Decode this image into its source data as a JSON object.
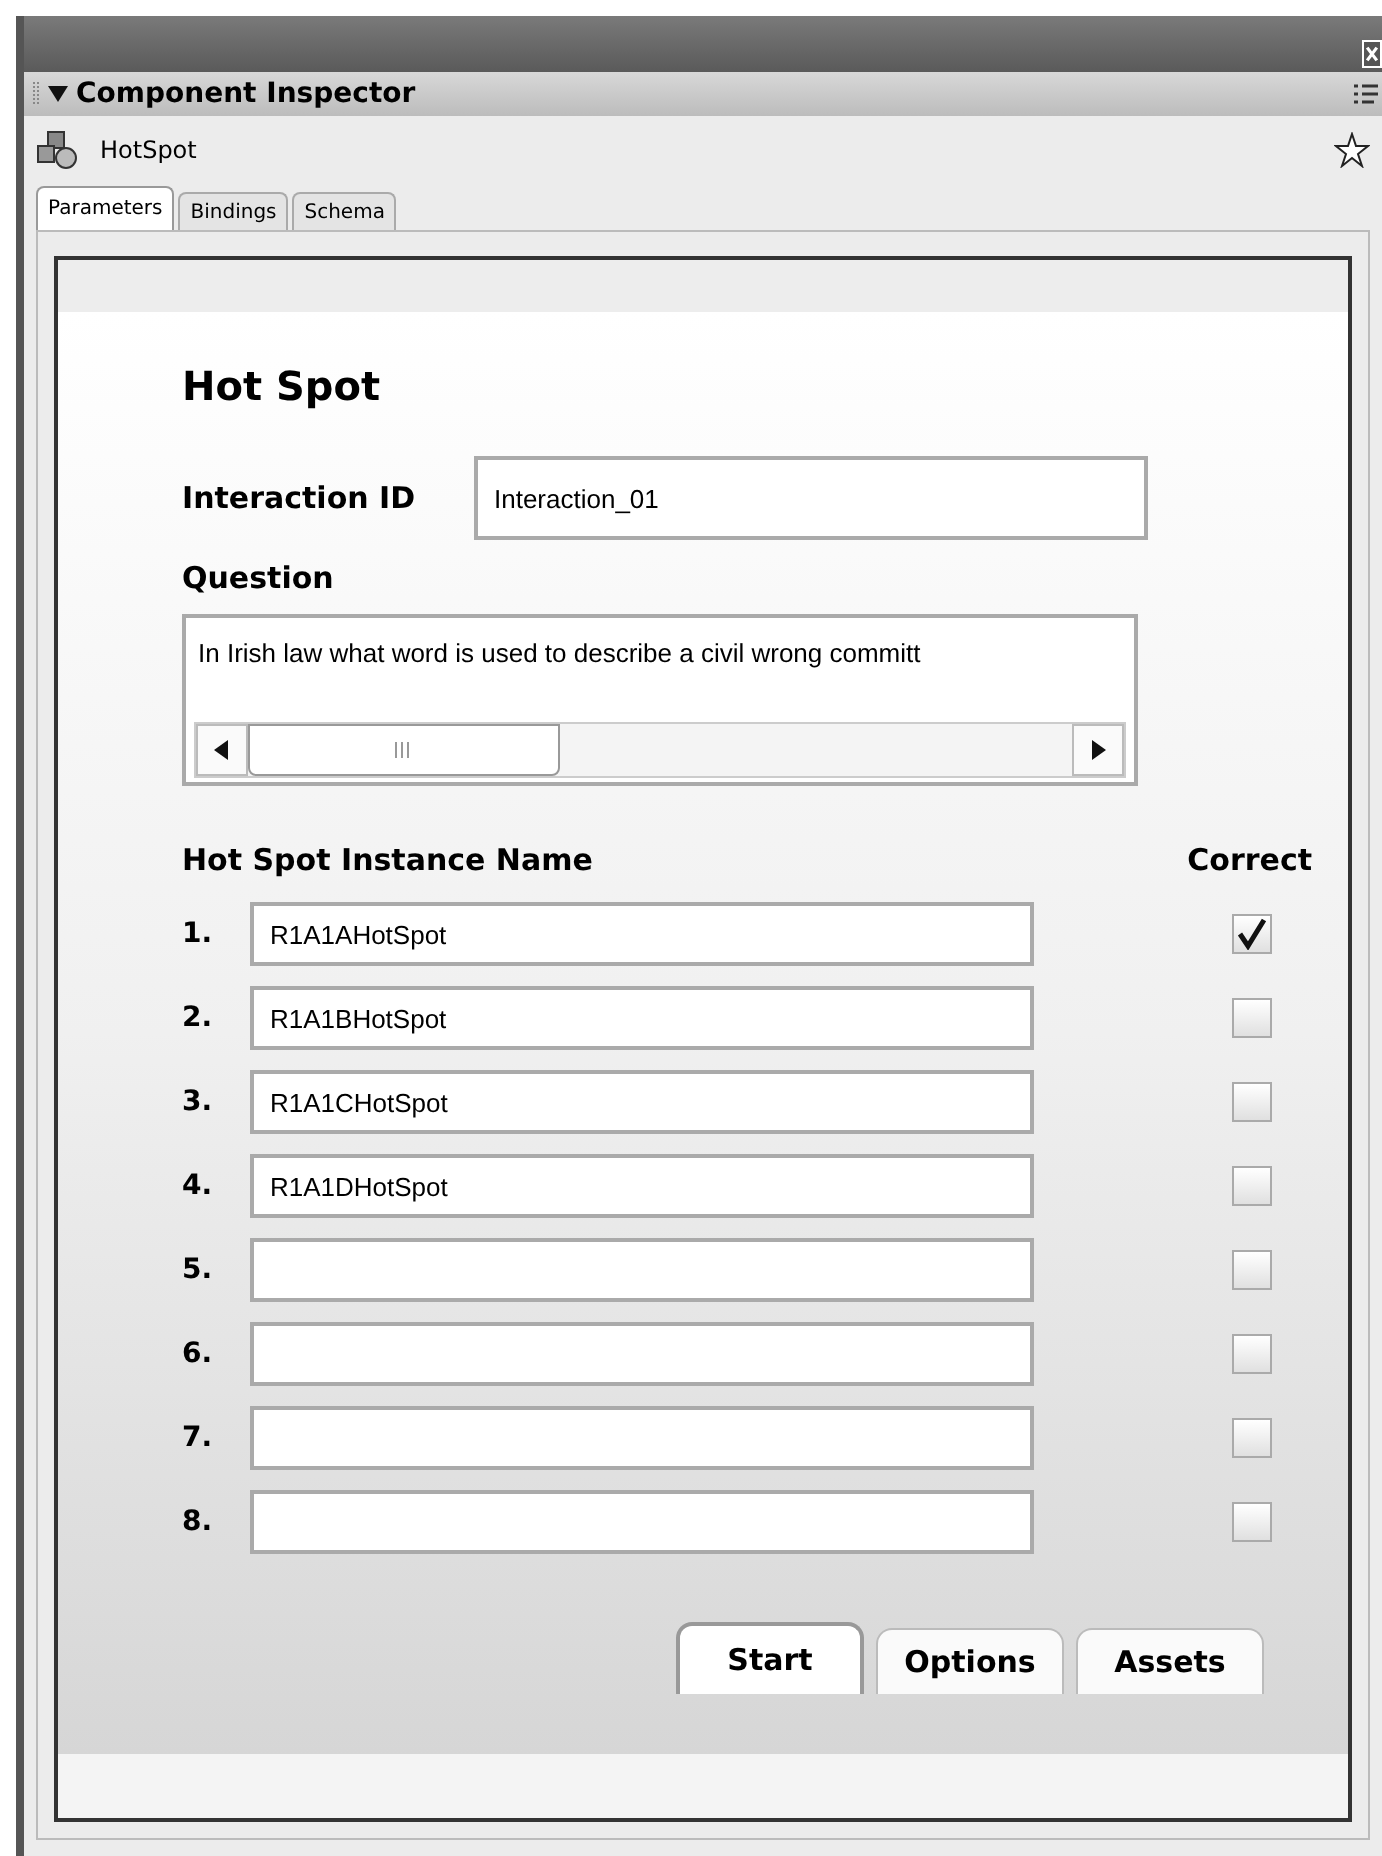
{
  "panel": {
    "title": "Component Inspector",
    "component_name": "HotSpot"
  },
  "tabs": [
    {
      "label": "Parameters",
      "selected": true
    },
    {
      "label": "Bindings",
      "selected": false
    },
    {
      "label": "Schema",
      "selected": false
    }
  ],
  "form": {
    "heading": "Hot Spot",
    "interaction_id_label": "Interaction ID",
    "interaction_id": "Interaction_01",
    "question_label": "Question",
    "question": "In Irish law what word is used to describe a civil wrong committ",
    "instance_header": "Hot Spot Instance Name",
    "correct_header": "Correct",
    "rows": [
      {
        "number": "1.",
        "value": "R1A1AHotSpot",
        "checked": true
      },
      {
        "number": "2.",
        "value": "R1A1BHotSpot",
        "checked": false
      },
      {
        "number": "3.",
        "value": "R1A1CHotSpot",
        "checked": false
      },
      {
        "number": "4.",
        "value": "R1A1DHotSpot",
        "checked": false
      },
      {
        "number": "5.",
        "checked": false
      },
      {
        "number": "6.",
        "checked": false
      },
      {
        "number": "7.",
        "checked": false
      },
      {
        "number": "8.",
        "checked": false
      }
    ]
  },
  "bottom_tabs": [
    {
      "label": "Start",
      "selected": true
    },
    {
      "label": "Options",
      "selected": false
    },
    {
      "label": "Assets",
      "selected": false
    }
  ]
}
